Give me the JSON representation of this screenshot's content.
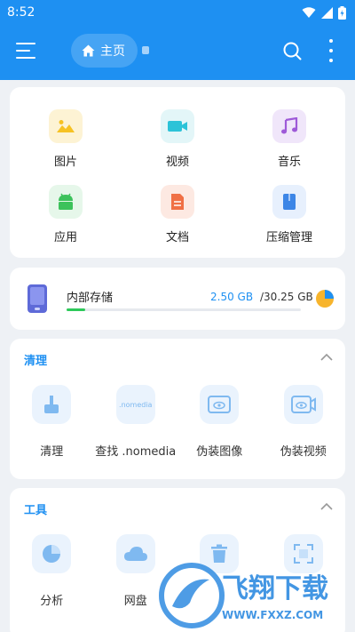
{
  "status": {
    "time": "8:52"
  },
  "appbar": {
    "home_label": "主页"
  },
  "quick_access": [
    {
      "label": "图片",
      "icon": "image-icon",
      "bg": "#fdf3d4",
      "fg": "#f6c223"
    },
    {
      "label": "视频",
      "icon": "video-icon",
      "bg": "#e3f6f8",
      "fg": "#2cc3d8"
    },
    {
      "label": "音乐",
      "icon": "music-icon",
      "bg": "#f0e6fa",
      "fg": "#9e5ad8"
    },
    {
      "label": "应用",
      "icon": "android-icon",
      "bg": "#e6f7ea",
      "fg": "#3cc25b"
    },
    {
      "label": "文档",
      "icon": "document-icon",
      "bg": "#fde9e2",
      "fg": "#f07045"
    },
    {
      "label": "压缩管理",
      "icon": "archive-icon",
      "bg": "#e7f0fd",
      "fg": "#3d86e6"
    }
  ],
  "storage": {
    "name": "内部存储",
    "used": "2.50 GB",
    "separator": "/",
    "total": "30.25 GB",
    "used_fraction": 0.08
  },
  "clean_section": {
    "title": "清理",
    "items": [
      {
        "label": "清理",
        "icon": "broom-icon"
      },
      {
        "label": "查找 .nomedia",
        "icon": "nomedia-icon",
        "icon_text": ".nomedia"
      },
      {
        "label": "伪装图像",
        "icon": "disguise-image-icon"
      },
      {
        "label": "伪装视频",
        "icon": "disguise-video-icon"
      }
    ]
  },
  "tools_section": {
    "title": "工具",
    "items": [
      {
        "label": "分析",
        "icon": "analysis-pie-icon"
      },
      {
        "label": "网盘",
        "icon": "cloud-icon"
      },
      {
        "label": "",
        "icon": "recycle-bin-icon"
      },
      {
        "label": "",
        "icon": "scan-icon"
      }
    ]
  },
  "watermark": {
    "text": "飞翔下载",
    "url": "WWW.FXXZ.COM"
  },
  "colors": {
    "primary": "#1e90f2",
    "storage_bar": "#2ec95a",
    "pie_used": "#1e90f2",
    "pie_free": "#f7b42c"
  }
}
